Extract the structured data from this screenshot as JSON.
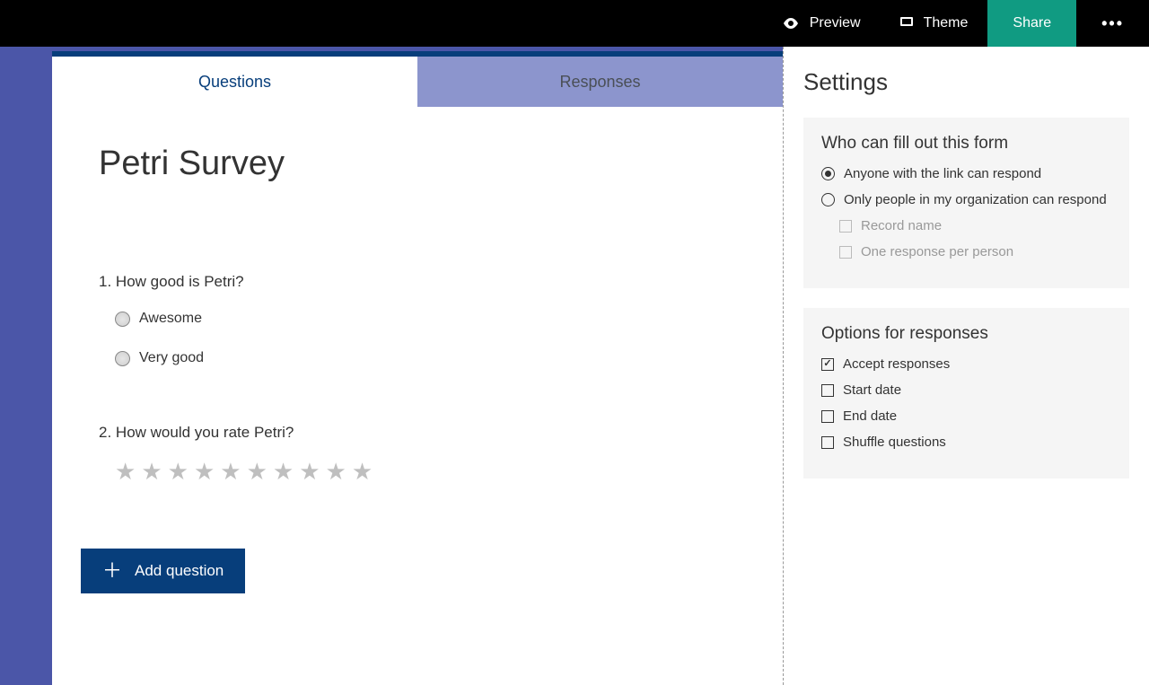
{
  "topbar": {
    "preview": "Preview",
    "theme": "Theme",
    "share": "Share",
    "more": "•••"
  },
  "tabs": {
    "questions": "Questions",
    "responses": "Responses"
  },
  "form": {
    "title": "Petri Survey",
    "q1": {
      "number": "1.",
      "text": "How good is Petri?",
      "choice1": "Awesome",
      "choice2": "Very good"
    },
    "q2": {
      "number": "2.",
      "text": "How would you rate Petri?",
      "stars_count": 10
    },
    "add_question": "Add question"
  },
  "settings": {
    "title": "Settings",
    "who": {
      "title": "Who can fill out this form",
      "anyone": "Anyone with the link can respond",
      "org": "Only people in my organization can respond",
      "record_name": "Record name",
      "one_response": "One response per person"
    },
    "options": {
      "title": "Options for responses",
      "accept": "Accept responses",
      "start": "Start date",
      "end": "End date",
      "shuffle": "Shuffle questions"
    }
  }
}
